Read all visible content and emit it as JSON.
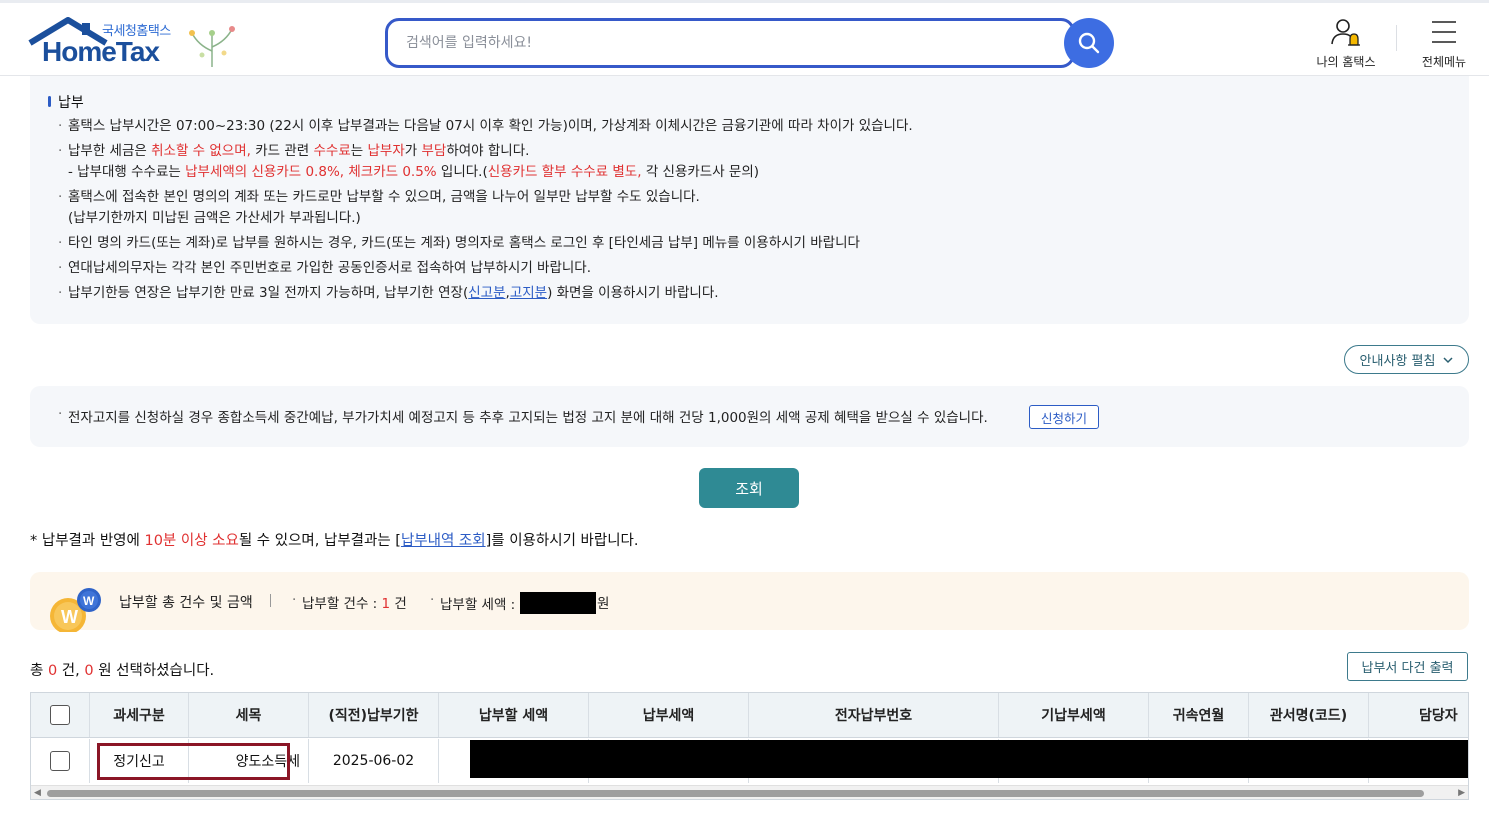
{
  "header": {
    "logo_sub": "국세청홈택스",
    "logo_main": "HomeTax",
    "search_placeholder": "검색어를 입력하세요!",
    "my_hometax": "나의 홈택스",
    "all_menu": "전체메뉴"
  },
  "notice": {
    "title": "납부",
    "item1": "홈택스 납부시간은 07:00~23:30 (22시 이후 납부결과는 다음날 07시 이후 확인 가능)이며, 가상계좌 이체시간은 금융기관에 따라 차이가 있습니다.",
    "item2_a": "납부한 세금은 ",
    "item2_b": "취소할 수 없으며,",
    "item2_c": " 카드 관련 ",
    "item2_d": "수수료",
    "item2_e": "는 ",
    "item2_f": "납부자",
    "item2_g": "가 ",
    "item2_h": "부담",
    "item2_i": "하여야 합니다.",
    "item2_sub_a": "- 납부대행 수수료는 ",
    "item2_sub_b": "납부세액의 신용카드 0.8%, 체크카드 0.5%",
    "item2_sub_c": " 입니다.(",
    "item2_sub_d": "신용카드 할부 수수료 별도,",
    "item2_sub_e": " 각 신용카드사 문의)",
    "item3": "홈택스에 접속한 본인 명의의 계좌 또는 카드로만 납부할 수 있으며, 금액을 나누어 일부만 납부할 수도 있습니다.",
    "item3_sub": "(납부기한까지 미납된 금액은 가산세가 부과됩니다.)",
    "item4": "타인 명의 카드(또는 계좌)로 납부를 원하시는 경우, 카드(또는 계좌) 명의자로 홈택스 로그인 후 [타인세금 납부] 메뉴를 이용하시기 바랍니다",
    "item5": "연대납세의무자는 각각 본인 주민번호로 가입한 공동인증서로 접속하여 납부하시기 바랍니다.",
    "item6_a": "납부기한등 연장은 납부기한 만료 3일 전까지 가능하며, 납부기한 연장(",
    "item6_link1": "신고분",
    "item6_comma": ",",
    "item6_link2": "고지분",
    "item6_b": ") 화면을 이용하시기 바랍니다."
  },
  "fold_button": "안내사항 펼침",
  "einfo": {
    "text": "전자고지를 신청하실 경우 종합소득세 중간예납, 부가가치세 예정고지 등 추후 고지되는 법정 고지 분에 대해 건당 1,000원의 세액 공제 혜택을 받으실 수 있습니다.",
    "apply": "신청하기"
  },
  "search_button": "조회",
  "result_note": {
    "a": "* 납부결과 반영에 ",
    "b": "10분 이상 소요",
    "c": "될 수 있으며, 납부결과는 [",
    "link": "납부내역 조회",
    "d": "]를 이용하시기 바랍니다."
  },
  "summary": {
    "title": "납부할 총 건수 및 금액",
    "count_label": "납부할 건수 : ",
    "count_value": "1",
    "count_unit": " 건",
    "amount_label": "납부할 세액 : ",
    "amount_unit": "원"
  },
  "selection": {
    "a": "총 ",
    "count": "0",
    "b": " 건, ",
    "amount": "0",
    "c": " 원 선택하셨습니다."
  },
  "print_button": "납부서 다건 출력",
  "table": {
    "headers": [
      "과세구분",
      "세목",
      "(직전)납부기한",
      "납부할 세액",
      "납부세액",
      "전자납부번호",
      "기납부세액",
      "귀속연월",
      "관서명(코드)",
      "담당자"
    ],
    "row": {
      "tax_class": "정기신고",
      "tax_item": "양도소득세",
      "due_date": "2025-06-02"
    }
  },
  "colors": {
    "brand_blue": "#3659c9",
    "primary_teal": "#2f8a94",
    "highlight_red": "#e03131",
    "row_highlight": "#8b1626"
  }
}
